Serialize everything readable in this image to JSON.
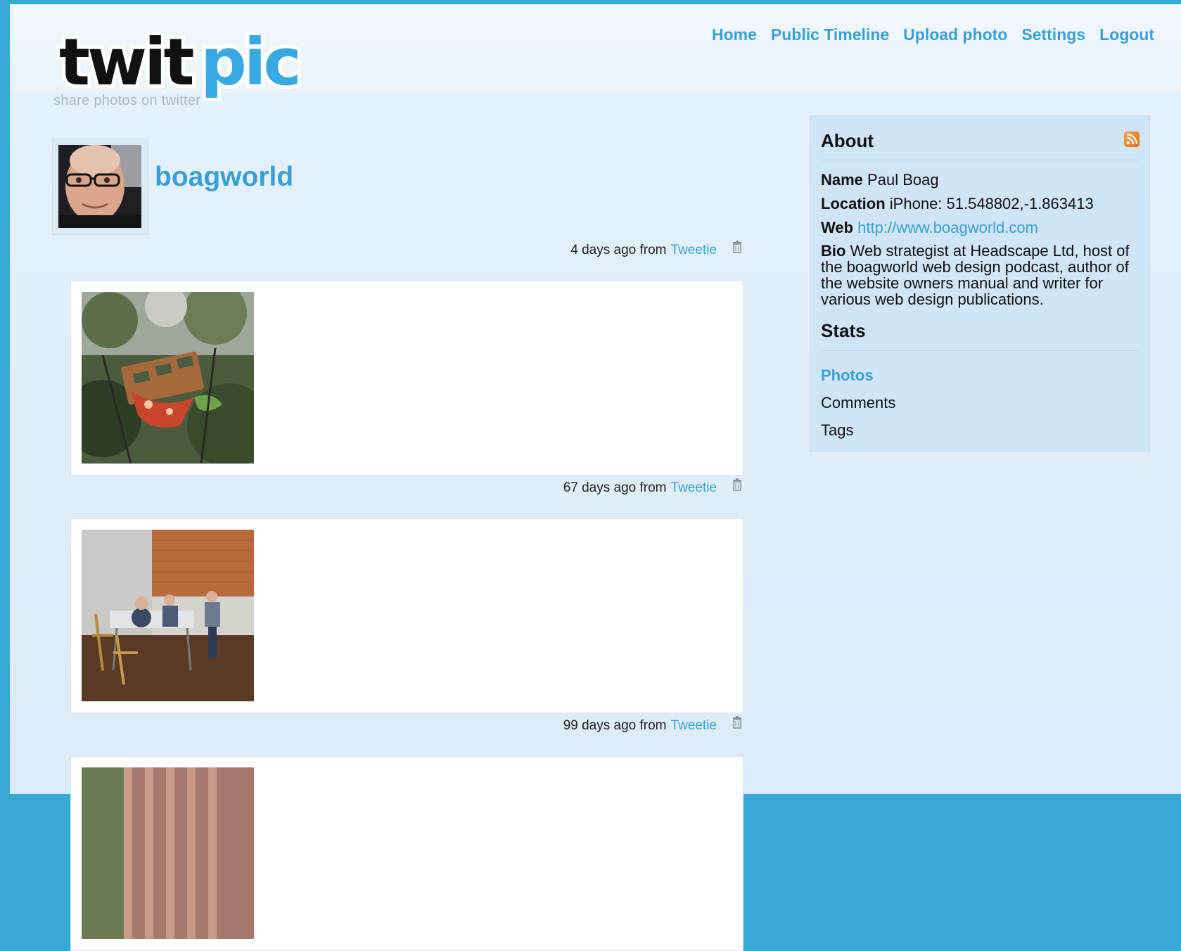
{
  "brand": {
    "logo_text_dark": "twit",
    "logo_text_blue": "pic",
    "tagline": "share photos on twitter",
    "colors": {
      "blue": "#3a9fd8",
      "dark": "#111111"
    }
  },
  "nav": {
    "items": [
      "Home",
      "Public Timeline",
      "Upload photo",
      "Settings",
      "Logout"
    ]
  },
  "profile": {
    "username": "boagworld"
  },
  "posts": [
    {
      "time": "4 days ago from",
      "source": "Tweetie"
    },
    {
      "time": "67 days ago from",
      "source": "Tweetie"
    },
    {
      "time": "99 days ago from",
      "source": "Tweetie"
    }
  ],
  "sidebar": {
    "about_title": "About",
    "name_label": "Name",
    "name_value": "Paul Boag",
    "location_label": "Location",
    "location_value": "iPhone: 51.548802,-1.863413",
    "web_label": "Web",
    "web_value": "http://www.boagworld.com",
    "bio_label": "Bio",
    "bio_value": "Web strategist at Headscape Ltd, host of the boagworld web design podcast, author of the website owners manual and writer for various web design publications.",
    "stats_title": "Stats",
    "stats_items": [
      "Photos",
      "Comments",
      "Tags"
    ]
  },
  "icons": [
    "rss-icon",
    "trash-icon"
  ]
}
